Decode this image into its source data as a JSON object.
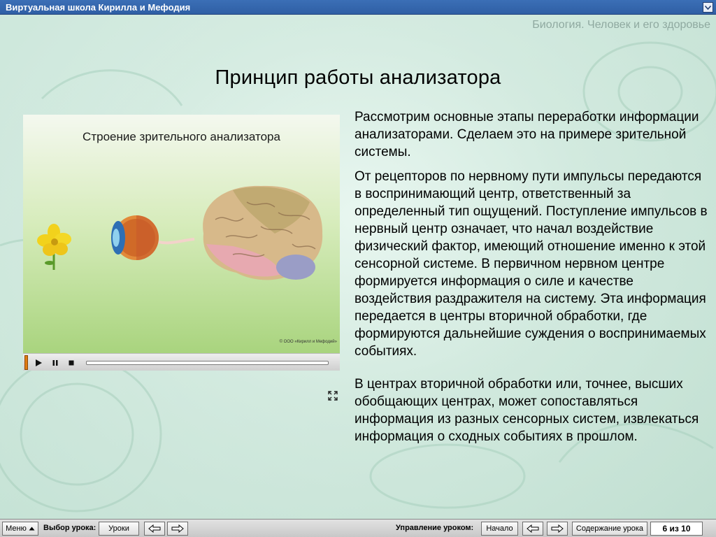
{
  "window": {
    "title": "Виртуальная школа Кирилла и Мефодия"
  },
  "header": {
    "subject": "Биология. Человек и его здоровье",
    "page_title": "Принцип работы анализатора"
  },
  "media": {
    "caption": "Строение зрительного анализатора",
    "copyright": "© ООО «Кирилл и Мефодий»",
    "illustration_icons": [
      "flower-icon",
      "eye-icon",
      "brain-icon"
    ],
    "controls": [
      "play-icon",
      "pause-icon",
      "stop-icon"
    ],
    "progress_fraction": 0
  },
  "body": {
    "paragraphs": [
      "Рассмотрим основные этапы переработки информации анализаторами. Сделаем это на примере зрительной системы.",
      "От рецепторов по нервному пути импульсы передаются в воспринимающий центр, ответственный за определенный тип ощущений. Поступление импульсов в нервный центр означает, что начал воздействие физический фактор, имеющий отношение именно к этой сенсорной системе. В первичном нервном центре формируется информация о силе и качестве воздействия раздражителя на систему. Эта информация передается в центры вторичной обработки, где формируются дальнейшие суждения о воспринимаемых событиях.",
      "В центрах вторичной обработки или, точнее, высших обобщающих центрах, может сопоставляться информация из разных сенсорных систем, извлекаться информация о сходных событиях в прошлом."
    ]
  },
  "toolbar": {
    "menu_label": "Меню",
    "lesson_select_label": "Выбор урока:",
    "lessons_button": "Уроки",
    "lesson_control_label": "Управление уроком:",
    "start_button": "Начало",
    "contents_button": "Содержание урока",
    "page_counter": "6 из 10"
  },
  "colors": {
    "titlebar": "#3b6fb6",
    "background": "#cfe7dd",
    "subject_text": "#8fa9a0",
    "progress_marker": "#e07b12"
  }
}
